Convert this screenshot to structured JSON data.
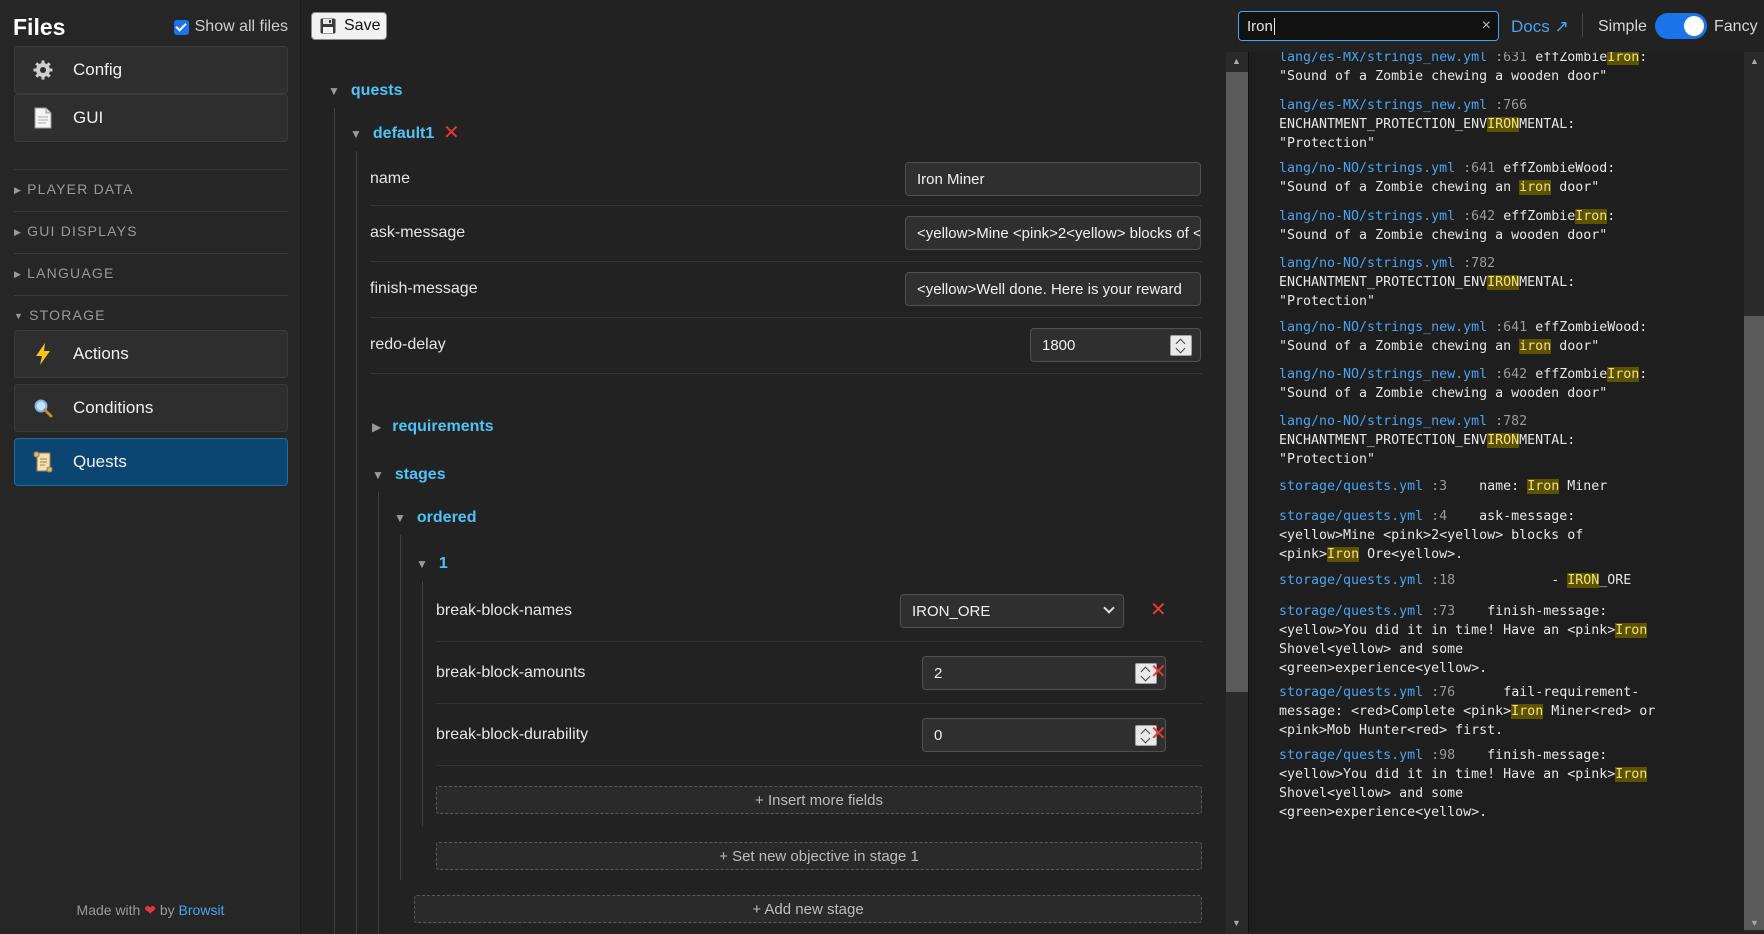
{
  "sidebar": {
    "title": "Files",
    "show_all_label": "Show all files",
    "top_items": [
      {
        "label": "Config",
        "icon": "gear-icon"
      },
      {
        "label": "GUI",
        "icon": "document-icon"
      }
    ],
    "sections": [
      "PLAYER DATA",
      "GUI DISPLAYS",
      "LANGUAGE",
      "STORAGE"
    ],
    "storage_items": [
      {
        "label": "Actions",
        "icon": "lightning-icon"
      },
      {
        "label": "Conditions",
        "icon": "magnifier-icon"
      },
      {
        "label": "Quests",
        "icon": "scroll-icon"
      }
    ],
    "footer_made": "Made with",
    "footer_by": "by",
    "footer_link": "Browsit"
  },
  "toolbar": {
    "save_label": "Save",
    "search_value": "Iron",
    "clear_symbol": "×",
    "docs_label": "Docs ↗",
    "mode_simple": "Simple",
    "mode_fancy": "Fancy",
    "fancy_enabled": true
  },
  "editor": {
    "root": "quests",
    "quest_id": "default1",
    "fields": {
      "name_label": "name",
      "name_value": "Iron Miner",
      "ask_label": "ask-message",
      "ask_value": "<yellow>Mine <pink>2<yellow> blocks of <pink>Iron Ore<yellow>.",
      "finish_label": "finish-message",
      "finish_value": "<yellow>Well done. Here is your reward",
      "redo_label": "redo-delay",
      "redo_value": "1800"
    },
    "requirements_label": "requirements",
    "stages_label": "stages",
    "ordered_label": "ordered",
    "stage_number": "1",
    "objective_fields": {
      "names_label": "break-block-names",
      "names_value": "IRON_ORE",
      "amounts_label": "break-block-amounts",
      "amounts_value": "2",
      "durability_label": "break-block-durability",
      "durability_value": "0"
    },
    "insert_more": "+ Insert more fields",
    "set_new_objective": "+ Set new objective in stage 1",
    "add_new_stage": "+ Add new stage"
  },
  "results": [
    {
      "path": "lang/es-MX/strings_new.yml",
      "line": ":631",
      "pre": "effZombie",
      "hl": "Iron",
      "post": ":",
      "line2": "\"Sound of a Zombie chewing a wooden door\""
    },
    {
      "path": "lang/es-MX/strings_new.yml",
      "line": ":766",
      "l2pre": "ENCHANTMENT_PROTECTION_ENV",
      "l2hl": "IRON",
      "l2post": "MENTAL:",
      "line3": "\"Protection\""
    },
    {
      "path": "lang/no-NO/strings.yml",
      "line": ":641",
      "pre": "effZombieWood:",
      "l2pre": "\"Sound of a Zombie chewing an ",
      "l2hl": "iron",
      "l2post": " door\""
    },
    {
      "path": "lang/no-NO/strings.yml",
      "line": ":642",
      "pre": "effZombie",
      "hl": "Iron",
      "post": ":",
      "line2": "\"Sound of a Zombie chewing a wooden door\""
    },
    {
      "path": "lang/no-NO/strings.yml",
      "line": ":782",
      "l2pre": "ENCHANTMENT_PROTECTION_ENV",
      "l2hl": "IRON",
      "l2post": "MENTAL:",
      "line3": "\"Protection\""
    },
    {
      "path": "lang/no-NO/strings_new.yml",
      "line": ":641",
      "pre": "effZombieWood:",
      "l2pre": "\"Sound of a Zombie chewing an ",
      "l2hl": "iron",
      "l2post": " door\""
    },
    {
      "path": "lang/no-NO/strings_new.yml",
      "line": ":642",
      "pre": "effZombie",
      "hl": "Iron",
      "post": ":",
      "line2": "\"Sound of a Zombie chewing a wooden door\""
    },
    {
      "path": "lang/no-NO/strings_new.yml",
      "line": ":782",
      "l2pre": "ENCHANTMENT_PROTECTION_ENV",
      "l2hl": "IRON",
      "l2post": "MENTAL:",
      "line3": "\"Protection\""
    },
    {
      "path": "storage/quests.yml",
      "line": ":3",
      "pre": "    name: ",
      "hl": "Iron",
      "post": " Miner"
    },
    {
      "path": "storage/quests.yml",
      "line": ":4",
      "pre": "    ask-message:",
      "line2": "<yellow>Mine <pink>2<yellow> blocks of",
      "l3pre": "<pink>",
      "l3hl": "Iron",
      "l3post": " Ore<yellow>."
    },
    {
      "path": "storage/quests.yml",
      "line": ":18",
      "pre": "            - ",
      "hl": "IRON",
      "post": "_ORE"
    },
    {
      "path": "storage/quests.yml",
      "line": ":73",
      "pre": "    finish-message:",
      "l2pre": "<yellow>You did it in time! Have an <pink>",
      "l2hl": "Iron",
      "line3": "Shovel<yellow> and some",
      "line4": "<green>experience<yellow>."
    },
    {
      "path": "storage/quests.yml",
      "line": ":76",
      "pre": "      fail-requirement-",
      "l2pre": "message: <red>Complete <pink>",
      "l2hl": "Iron",
      "l2post": " Miner<red> or",
      "line3": "<pink>Mob Hunter<red> first."
    },
    {
      "path": "storage/quests.yml",
      "line": ":98",
      "pre": "    finish-message:",
      "l2pre": "<yellow>You did it in time! Have an <pink>",
      "l2hl": "Iron",
      "line3": "Shovel<yellow> and some",
      "line4": "<green>experience<yellow>."
    }
  ],
  "colors": {
    "accent": "#4aa3f0",
    "tree_key": "#4fc3f7",
    "delete": "#e53935",
    "active_nav": "#0b4673",
    "highlight": "#5c5200"
  }
}
